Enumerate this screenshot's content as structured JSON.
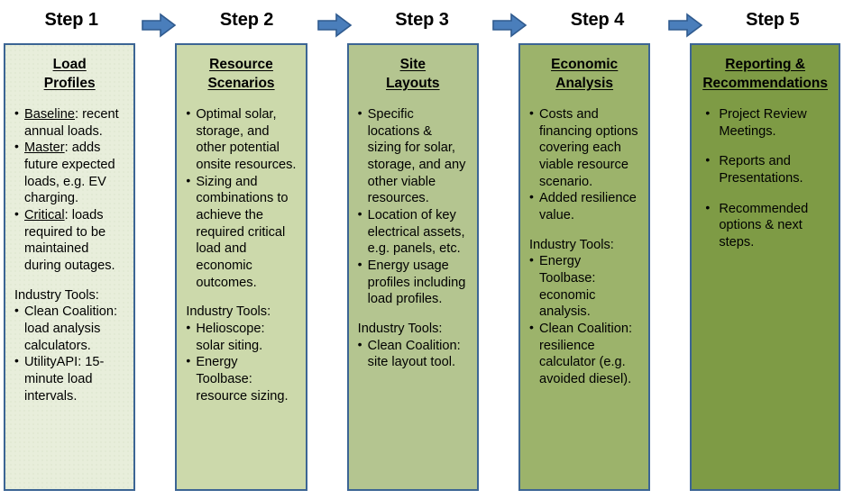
{
  "colors": {
    "box_border": "#3c6594",
    "arrow_fill": "#4a7ebb",
    "arrow_border": "#2f5a8e",
    "step1_bg": "#e8eedb",
    "step2_bg": "#ccd9ab",
    "step3_bg": "#b4c590",
    "step4_bg": "#9cb36b",
    "step5_bg": "#7e9b45",
    "text": "#000000"
  },
  "arrow_icon_name": "right-arrow-icon",
  "steps": [
    {
      "label": "Step 1",
      "heading_line1": "Load",
      "heading_line2": "Profiles",
      "bullets": [
        {
          "term": "Baseline",
          "text": ": recent annual loads."
        },
        {
          "term": "Master",
          "text": ": adds future expected loads, e.g. EV charging."
        },
        {
          "term": "Critical",
          "text": ": loads required to be maintained during outages."
        }
      ],
      "tools_label": "Industry Tools:",
      "tools": [
        {
          "term": "",
          "text": "Clean Coalition: load analysis calculators."
        },
        {
          "term": "",
          "text": "UtilityAPI: 15-minute load intervals."
        }
      ]
    },
    {
      "label": "Step 2",
      "heading_line1": "Resource",
      "heading_line2": "Scenarios",
      "bullets": [
        {
          "term": "",
          "text": "Optimal solar, storage, and other potential onsite resources."
        },
        {
          "term": "",
          "text": "Sizing and combinations to achieve the required critical load and economic outcomes."
        }
      ],
      "tools_label": "Industry Tools:",
      "tools": [
        {
          "term": "",
          "text": "Helioscope: solar siting."
        },
        {
          "term": "",
          "text": "Energy Toolbase: resource sizing."
        }
      ]
    },
    {
      "label": "Step 3",
      "heading_line1": "Site",
      "heading_line2": "Layouts",
      "bullets": [
        {
          "term": "",
          "text": "Specific locations & sizing for solar, storage, and any other viable resources."
        },
        {
          "term": "",
          "text": "Location of key electrical assets, e.g. panels, etc."
        },
        {
          "term": "",
          "text": "Energy usage profiles including load profiles."
        }
      ],
      "tools_label": "Industry Tools:",
      "tools": [
        {
          "term": "",
          "text": "Clean Coalition: site layout tool."
        }
      ]
    },
    {
      "label": "Step 4",
      "heading_line1": "Economic",
      "heading_line2": "Analysis",
      "bullets": [
        {
          "term": "",
          "text": "Costs and financing options covering each viable resource scenario."
        },
        {
          "term": "",
          "text": "Added resilience value."
        }
      ],
      "tools_label": "Industry Tools:",
      "tools": [
        {
          "term": "",
          "text": "Energy Toolbase: economic analysis."
        },
        {
          "term": "",
          "text": "Clean Coalition: resilience calculator (e.g. avoided diesel)."
        }
      ]
    },
    {
      "label": "Step 5",
      "heading_line1": "Reporting &",
      "heading_line2": "Recommendations",
      "bullets": [
        {
          "term": "",
          "text": "Project Review Meetings."
        },
        {
          "term": "",
          "text": "Reports and Presentations."
        },
        {
          "term": "",
          "text": "Recommended options & next steps."
        }
      ],
      "tools_label": "",
      "tools": []
    }
  ]
}
